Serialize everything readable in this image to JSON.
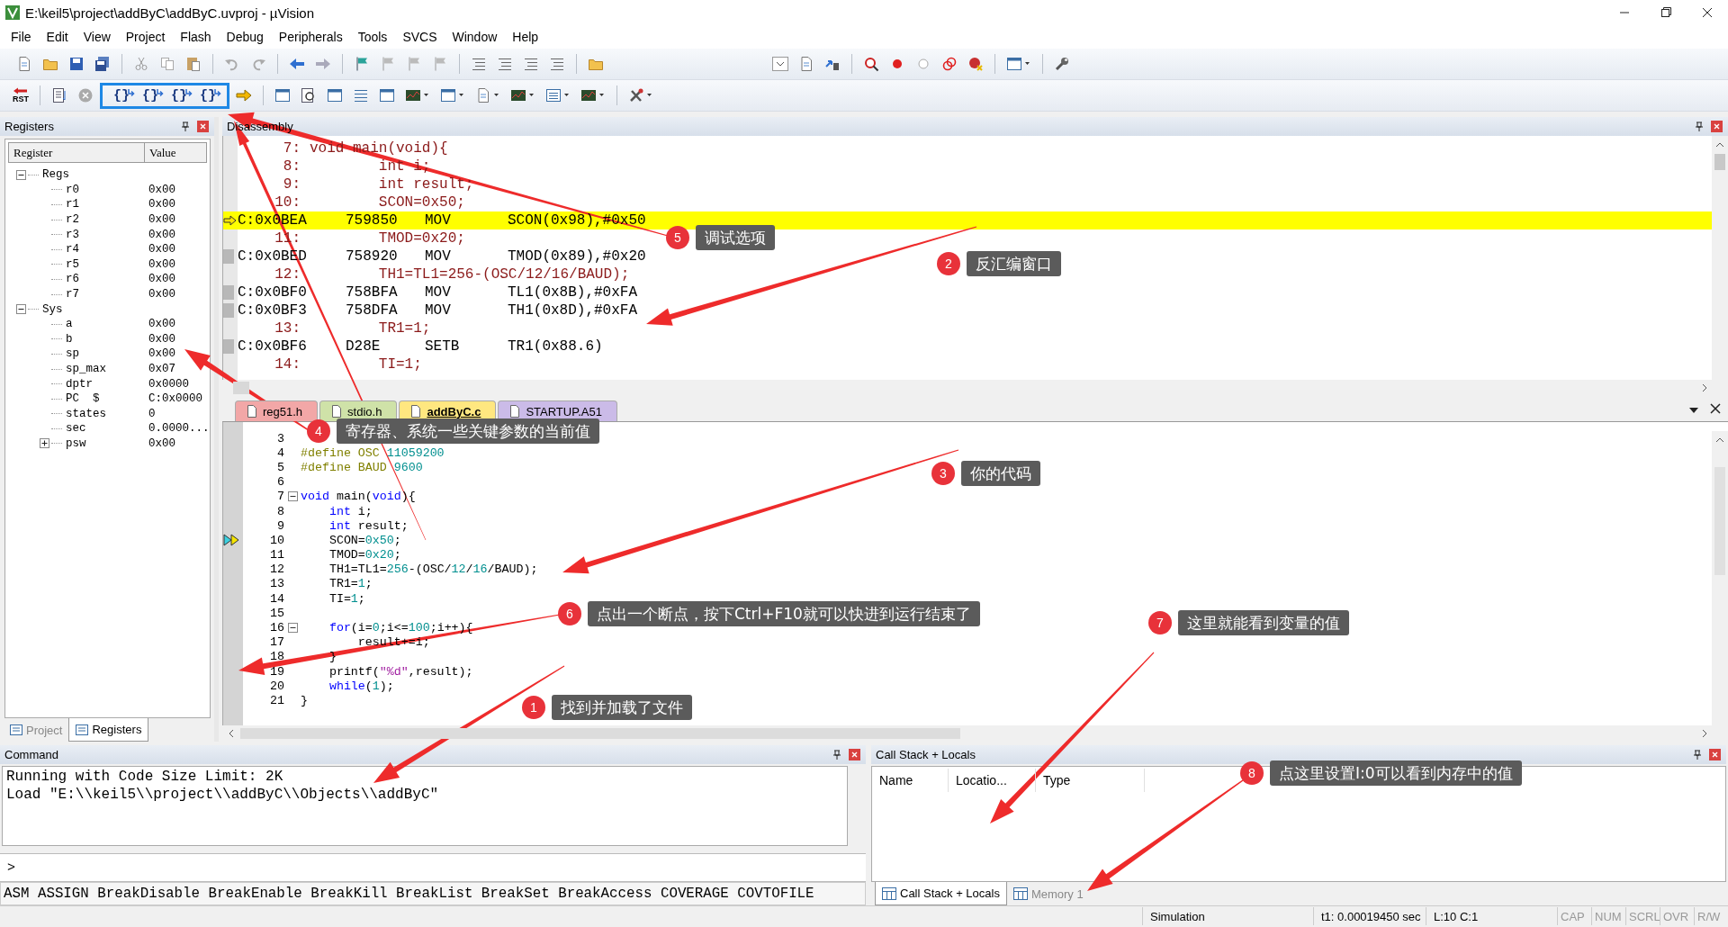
{
  "window": {
    "title": "E:\\keil5\\project\\addByC\\addByC.uvproj - µVision"
  },
  "menu": [
    "File",
    "Edit",
    "View",
    "Project",
    "Flash",
    "Debug",
    "Peripherals",
    "Tools",
    "SVCS",
    "Window",
    "Help"
  ],
  "toolbar": {
    "reset_label": "RST",
    "step_buttons": [
      "{}",
      "{}",
      "{}",
      "{}"
    ]
  },
  "registers": {
    "title": "Registers",
    "columns": [
      "Register",
      "Value"
    ],
    "tree": [
      {
        "name": "Regs",
        "expanded": true,
        "children": [
          {
            "name": "r0",
            "value": "0x00"
          },
          {
            "name": "r1",
            "value": "0x00"
          },
          {
            "name": "r2",
            "value": "0x00"
          },
          {
            "name": "r3",
            "value": "0x00"
          },
          {
            "name": "r4",
            "value": "0x00"
          },
          {
            "name": "r5",
            "value": "0x00"
          },
          {
            "name": "r6",
            "value": "0x00"
          },
          {
            "name": "r7",
            "value": "0x00"
          }
        ]
      },
      {
        "name": "Sys",
        "expanded": true,
        "children": [
          {
            "name": "a",
            "value": "0x00"
          },
          {
            "name": "b",
            "value": "0x00"
          },
          {
            "name": "sp",
            "value": "0x00"
          },
          {
            "name": "sp_max",
            "value": "0x07"
          },
          {
            "name": "dptr",
            "value": "0x0000"
          },
          {
            "name": "PC  $",
            "value": "C:0x0000"
          },
          {
            "name": "states",
            "value": "0"
          },
          {
            "name": "sec",
            "value": "0.0000..."
          },
          {
            "name": "psw",
            "value": "0x00",
            "expanded": false
          }
        ]
      }
    ],
    "tabs": [
      {
        "label": "Project",
        "selected": false
      },
      {
        "label": "Registers",
        "selected": true
      }
    ]
  },
  "disassembly": {
    "title": "Disassembly",
    "rows": [
      {
        "kind": "source",
        "line": "7:",
        "text": "void main(void){"
      },
      {
        "kind": "source",
        "line": "8:",
        "text": "        int i;"
      },
      {
        "kind": "source",
        "line": "9:",
        "text": "        int result;"
      },
      {
        "kind": "source",
        "line": "10:",
        "text": "        SCON=0x50;"
      },
      {
        "kind": "asm",
        "address": "C:0x0BEA",
        "code": "759850",
        "mnemonic": "MOV",
        "operands": "SCON(0x98),#0x50",
        "current": true
      },
      {
        "kind": "source",
        "line": "11:",
        "text": "        TMOD=0x20;"
      },
      {
        "kind": "asm",
        "address": "C:0x0BED",
        "code": "758920",
        "mnemonic": "MOV",
        "operands": "TMOD(0x89),#0x20",
        "current": false
      },
      {
        "kind": "source",
        "line": "12:",
        "text": "        TH1=TL1=256-(OSC/12/16/BAUD);"
      },
      {
        "kind": "asm",
        "address": "C:0x0BF0",
        "code": "758BFA",
        "mnemonic": "MOV",
        "operands": "TL1(0x8B),#0xFA",
        "current": false
      },
      {
        "kind": "asm",
        "address": "C:0x0BF3",
        "code": "758DFA",
        "mnemonic": "MOV",
        "operands": "TH1(0x8D),#0xFA",
        "current": false
      },
      {
        "kind": "source",
        "line": "13:",
        "text": "        TR1=1;"
      },
      {
        "kind": "asm",
        "address": "C:0x0BF6",
        "code": "D28E",
        "mnemonic": "SETB",
        "operands": "TR1(0x88.6)",
        "current": false
      },
      {
        "kind": "source",
        "line": "14:",
        "text": "        TI=1;"
      }
    ]
  },
  "editor": {
    "tabs": [
      {
        "label": "reg51.h",
        "color": "#f2a7a7",
        "selected": false
      },
      {
        "label": "stdio.h",
        "color": "#cfe2a8",
        "selected": false
      },
      {
        "label": "addByC.c",
        "color": "#ffe780",
        "selected": true
      },
      {
        "label": "STARTUP.A51",
        "color": "#cbbbe8",
        "selected": false
      }
    ],
    "lines": [
      {
        "number": "3"
      },
      {
        "number": "4",
        "tokens": [
          {
            "kind": "directive",
            "text": "#define OSC "
          },
          {
            "kind": "number",
            "text": "11059200"
          }
        ]
      },
      {
        "number": "5",
        "tokens": [
          {
            "kind": "directive",
            "text": "#define BAUD "
          },
          {
            "kind": "number",
            "text": "9600"
          }
        ]
      },
      {
        "number": "6"
      },
      {
        "number": "7",
        "fold": true,
        "tokens": [
          {
            "kind": "keyword",
            "text": "void"
          },
          {
            "kind": "plain",
            "text": " main("
          },
          {
            "kind": "keyword",
            "text": "void"
          },
          {
            "kind": "plain",
            "text": "){"
          }
        ]
      },
      {
        "number": "8",
        "tokens": [
          {
            "kind": "keyword",
            "text": "    int"
          },
          {
            "kind": "plain",
            "text": " i;"
          }
        ]
      },
      {
        "number": "9",
        "tokens": [
          {
            "kind": "keyword",
            "text": "    int"
          },
          {
            "kind": "plain",
            "text": " result;"
          }
        ]
      },
      {
        "number": "10",
        "current": true,
        "tokens": [
          {
            "kind": "plain",
            "text": "    SCON="
          },
          {
            "kind": "number",
            "text": "0x50"
          },
          {
            "kind": "plain",
            "text": ";"
          }
        ]
      },
      {
        "number": "11",
        "tokens": [
          {
            "kind": "plain",
            "text": "    TMOD="
          },
          {
            "kind": "number",
            "text": "0x20"
          },
          {
            "kind": "plain",
            "text": ";"
          }
        ]
      },
      {
        "number": "12",
        "tokens": [
          {
            "kind": "plain",
            "text": "    TH1=TL1="
          },
          {
            "kind": "number",
            "text": "256"
          },
          {
            "kind": "plain",
            "text": "-(OSC/"
          },
          {
            "kind": "number",
            "text": "12"
          },
          {
            "kind": "plain",
            "text": "/"
          },
          {
            "kind": "number",
            "text": "16"
          },
          {
            "kind": "plain",
            "text": "/BAUD);"
          }
        ]
      },
      {
        "number": "13",
        "tokens": [
          {
            "kind": "plain",
            "text": "    TR1="
          },
          {
            "kind": "number",
            "text": "1"
          },
          {
            "kind": "plain",
            "text": ";"
          }
        ]
      },
      {
        "number": "14",
        "tokens": [
          {
            "kind": "plain",
            "text": "    TI="
          },
          {
            "kind": "number",
            "text": "1"
          },
          {
            "kind": "plain",
            "text": ";"
          }
        ]
      },
      {
        "number": "15"
      },
      {
        "number": "16",
        "fold": true,
        "tokens": [
          {
            "kind": "keyword",
            "text": "    for"
          },
          {
            "kind": "plain",
            "text": "(i="
          },
          {
            "kind": "number",
            "text": "0"
          },
          {
            "kind": "plain",
            "text": ";i<="
          },
          {
            "kind": "number",
            "text": "100"
          },
          {
            "kind": "plain",
            "text": ";i++){"
          }
        ]
      },
      {
        "number": "17",
        "tokens": [
          {
            "kind": "plain",
            "text": "        result+=i;"
          }
        ]
      },
      {
        "number": "18",
        "tokens": [
          {
            "kind": "plain",
            "text": "    }"
          }
        ]
      },
      {
        "number": "19",
        "tokens": [
          {
            "kind": "plain",
            "text": "    printf("
          },
          {
            "kind": "string",
            "text": "\"%d\""
          },
          {
            "kind": "plain",
            "text": ",result);"
          }
        ]
      },
      {
        "number": "20",
        "tokens": [
          {
            "kind": "keyword",
            "text": "    while"
          },
          {
            "kind": "plain",
            "text": "("
          },
          {
            "kind": "number",
            "text": "1"
          },
          {
            "kind": "plain",
            "text": ");"
          }
        ]
      },
      {
        "number": "21",
        "tokens": [
          {
            "kind": "plain",
            "text": "}"
          }
        ]
      }
    ]
  },
  "command": {
    "title": "Command",
    "output": [
      "Running with Code Size Limit: 2K",
      "Load \"E:\\\\keil5\\\\project\\\\addByC\\\\Objects\\\\addByC\""
    ],
    "prompt": ">",
    "commands": "ASM ASSIGN BreakDisable BreakEnable BreakKill BreakList BreakSet BreakAccess COVERAGE COVTOFILE"
  },
  "call_stack": {
    "title": "Call Stack + Locals",
    "columns": [
      "Name",
      "Locatio...",
      "Type"
    ],
    "tabs": [
      {
        "label": "Call Stack + Locals",
        "selected": true
      },
      {
        "label": "Memory 1",
        "selected": false
      }
    ]
  },
  "status_bar": {
    "mode": "Simulation",
    "time": "t1: 0.00019450 sec",
    "position": "L:10 C:1",
    "indicators": [
      {
        "label": "CAP",
        "on": false
      },
      {
        "label": "NUM",
        "on": false
      },
      {
        "label": "SCRL",
        "on": false
      },
      {
        "label": "OVR",
        "on": false
      },
      {
        "label": "R/W",
        "on": false
      }
    ]
  },
  "annotations": [
    {
      "number": "5",
      "text": "调试选项"
    },
    {
      "number": "2",
      "text": "反汇编窗口"
    },
    {
      "number": "4",
      "text": "寄存器、系统一些关键参数的当前值"
    },
    {
      "number": "3",
      "text": "你的代码"
    },
    {
      "number": "6",
      "text": "点出一个断点，按下Ctrl+F10就可以快进到运行结束了"
    },
    {
      "number": "7",
      "text": "这里就能看到变量的值"
    },
    {
      "number": "1",
      "text": "找到并加载了文件"
    },
    {
      "number": "8",
      "text": "点这里设置I:0可以看到内存中的值"
    }
  ]
}
